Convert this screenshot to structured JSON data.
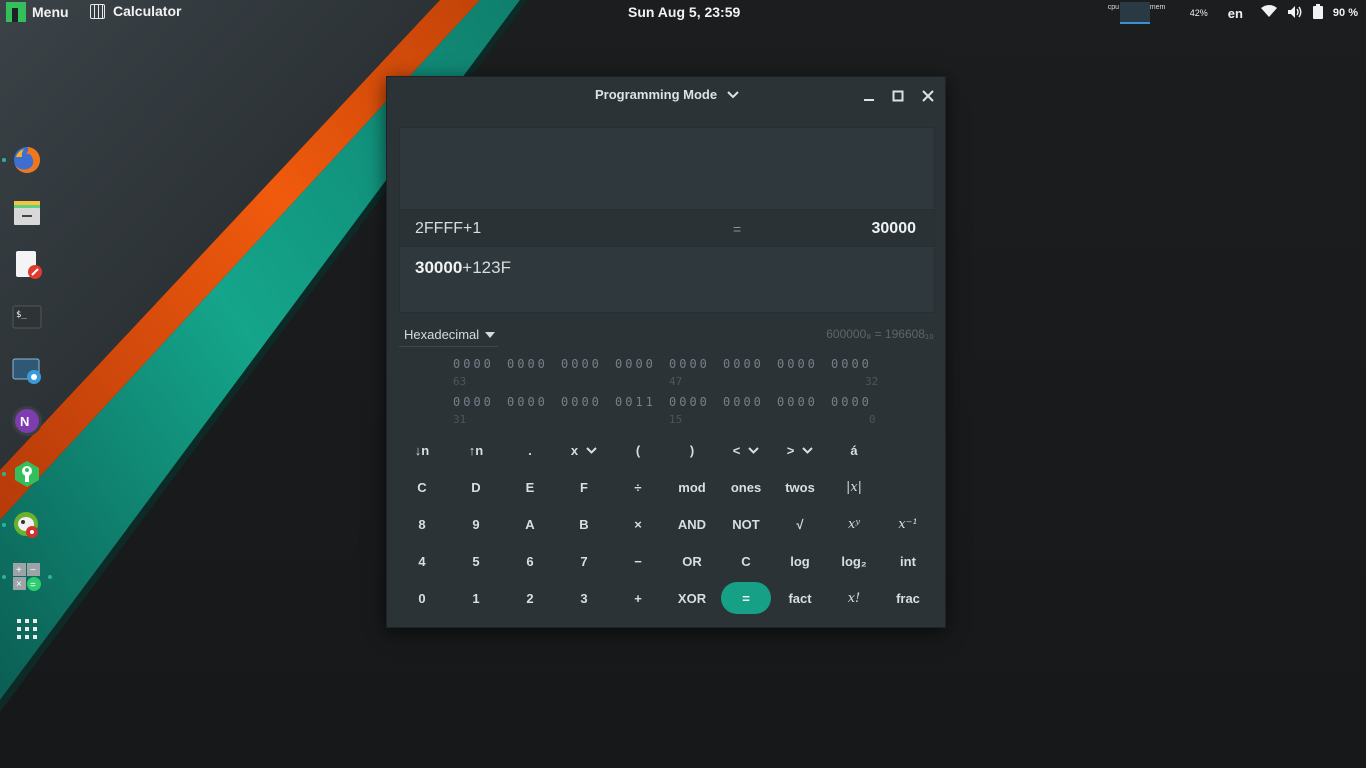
{
  "panel": {
    "menu_label": "Menu",
    "active_app": "Calculator",
    "clock": "Sun Aug  5, 23:59",
    "sysmon_cpu": "cpu",
    "sysmon_mem": "mem",
    "sysmon_pct": "42%",
    "language": "en",
    "battery": "90 %"
  },
  "dock": {
    "items": [
      "firefox",
      "file-manager",
      "text-editor",
      "terminal",
      "screenshot",
      "onenote",
      "settings-manager",
      "gimp",
      "calculator",
      "app-grid"
    ]
  },
  "calculator": {
    "mode_title": "Programming Mode",
    "history": {
      "expression": "2FFFF+1",
      "equals": "=",
      "result": "30000"
    },
    "entry": {
      "bold": "30000",
      "rest": "+123F"
    },
    "base_selected": "Hexadecimal",
    "base_info": "600000₈ = 196608₁₀",
    "bit_rows": [
      [
        "0000",
        "0000",
        "0000",
        "0000",
        "0000",
        "0000",
        "0000",
        "0000"
      ],
      [
        "0000",
        "0000",
        "0000",
        "0011",
        "0000",
        "0000",
        "0000",
        "0000"
      ]
    ],
    "bit_index_rows": [
      [
        "63",
        "47",
        "32"
      ],
      [
        "31",
        "15",
        "0"
      ]
    ],
    "keys": [
      [
        "↓n",
        "↑n",
        ".",
        "x",
        "(",
        ")",
        "<",
        ">",
        "á"
      ],
      [
        "C",
        "D",
        "E",
        "F",
        "÷",
        "mod",
        "ones",
        "twos",
        "|x|"
      ],
      [
        "8",
        "9",
        "A",
        "B",
        "×",
        "AND",
        "NOT",
        "√",
        "xʸ",
        "x⁻¹"
      ],
      [
        "4",
        "5",
        "6",
        "7",
        "−",
        "OR",
        "C",
        "log",
        "log₂",
        "int"
      ],
      [
        "0",
        "1",
        "2",
        "3",
        "+",
        "XOR",
        "=",
        "fact",
        "x!",
        "frac"
      ]
    ]
  },
  "colors": {
    "accent": "#16a085",
    "window_bg": "#2b3337",
    "wallpaper_orange": "#e5500e",
    "wallpaper_teal": "#13917c",
    "manjaro_green": "#35bf5c"
  }
}
